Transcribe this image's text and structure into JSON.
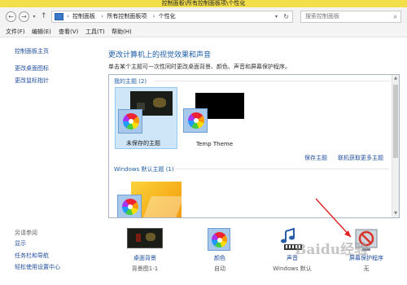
{
  "window": {
    "title": "控制面板\\所有控制面板项\\个性化"
  },
  "address": {
    "crumbs": [
      "控制面板",
      "所有控制面板项",
      "个性化"
    ],
    "separator": "›",
    "search_placeholder": "搜索控制面板"
  },
  "menu": {
    "items": [
      "文件(F)",
      "编辑(E)",
      "查看(V)",
      "工具(T)",
      "帮助(H)"
    ]
  },
  "sidebar": {
    "home": "控制面板主页",
    "links": [
      "更改桌面图标",
      "更改鼠标指针"
    ],
    "see_also": "另请参阅",
    "see_also_links": [
      "显示",
      "任务栏和导航",
      "轻松使用设置中心"
    ]
  },
  "main": {
    "heading": "更改计算机上的视觉效果和声音",
    "description": "单击某个主题可一次性同时更改桌面背景、颜色、声音和屏幕保护程序。",
    "my_themes_label": "我的主题 (2)",
    "themes": [
      {
        "name": "未保存的主题",
        "selected": true
      },
      {
        "name": "Temp Theme",
        "selected": false
      }
    ],
    "save_theme": "保存主题",
    "get_more_online": "联机获取更多主题",
    "windows_themes_label": "Windows 默认主题 (1)"
  },
  "bottom": {
    "options": [
      {
        "label": "桌面背景",
        "sub": "背景图1-1",
        "icon": "desktop-background-icon"
      },
      {
        "label": "颜色",
        "sub": "自动",
        "icon": "color-palette-icon"
      },
      {
        "label": "声音",
        "sub": "Windows 默认",
        "icon": "sound-icon"
      },
      {
        "label": "屏幕保护程序",
        "sub": "无",
        "icon": "screensaver-icon"
      }
    ]
  },
  "watermark": "Baidu经验",
  "colors": {
    "title_bar": "#f3df4a",
    "link": "#1e4e9e",
    "heading": "#1f5fa8",
    "selection": "#cfe6f9",
    "annotation_arrow": "#e02020"
  }
}
